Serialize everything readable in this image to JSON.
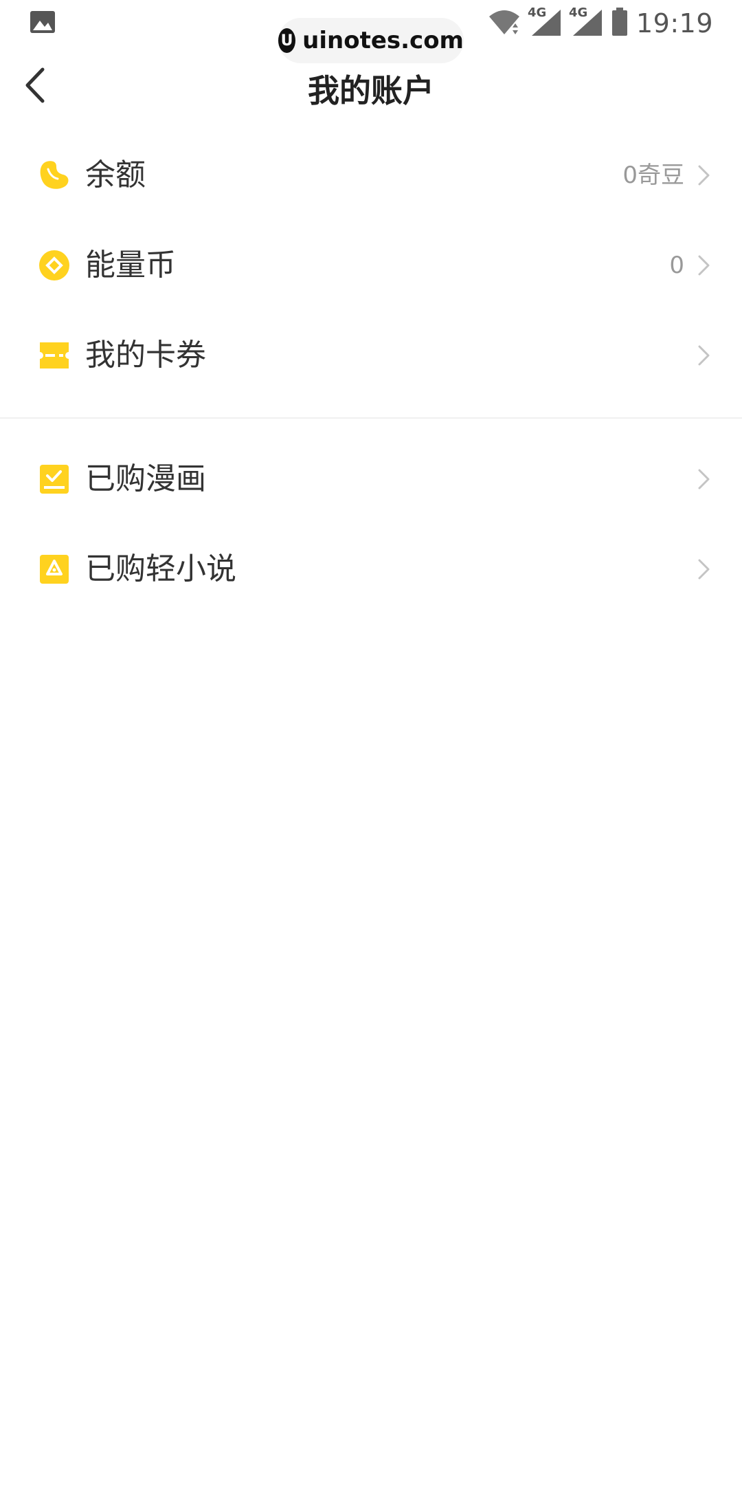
{
  "status_bar": {
    "time": "19:19",
    "network_1": "4G",
    "network_2": "4G",
    "icons": [
      "image-icon",
      "wifi-icon",
      "signal-icon",
      "signal-icon",
      "battery-icon"
    ]
  },
  "watermark": {
    "logo": "U",
    "text": "uinotes.com"
  },
  "header": {
    "title": "我的账户",
    "back_icon": "chevron-left-icon"
  },
  "accent_color": "#FFD21F",
  "section_1": [
    {
      "label": "余额",
      "value": "0奇豆",
      "icon": "bean-icon"
    },
    {
      "label": "能量币",
      "value": "0",
      "icon": "coin-icon"
    },
    {
      "label": "我的卡券",
      "value": "",
      "icon": "ticket-icon"
    }
  ],
  "section_2": [
    {
      "label": "已购漫画",
      "value": "",
      "icon": "comic-book-icon"
    },
    {
      "label": "已购轻小说",
      "value": "",
      "icon": "novel-icon"
    }
  ]
}
